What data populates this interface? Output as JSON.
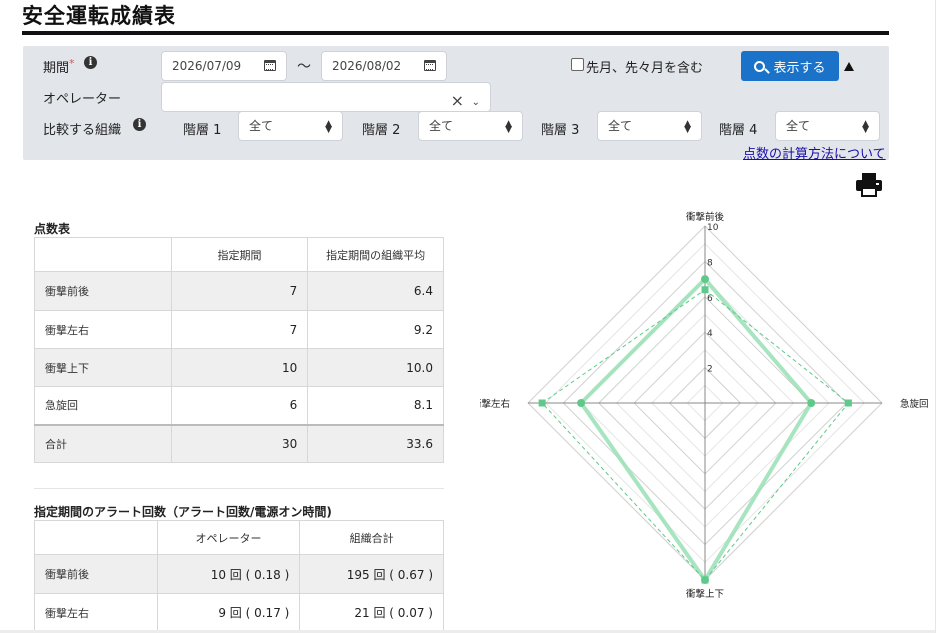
{
  "page": {
    "title": "安全運転成績表"
  },
  "filters": {
    "period_label": "期間",
    "required_mark": "*",
    "info_glyph": "i",
    "date_from": "2026/07/09",
    "date_to": "2026/08/02",
    "range_sep": "〜",
    "include_prev_label": "先月、先々月を含む",
    "include_prev_checked": false,
    "show_button_label": "表示する",
    "operator_label": "オペレーター",
    "operator_value": "",
    "clear_glyph": "×",
    "chevron_glyph": "⌄",
    "compare_label": "比較する組織",
    "levels": [
      {
        "label": "階層 1",
        "value": "全て"
      },
      {
        "label": "階層 2",
        "value": "全て"
      },
      {
        "label": "階層 3",
        "value": "全て"
      },
      {
        "label": "階層 4",
        "value": "全て"
      }
    ],
    "calc_link": "点数の計算方法について"
  },
  "score_table": {
    "title": "点数表",
    "headers": [
      "",
      "指定期間",
      "指定期間の組織平均"
    ],
    "rows": [
      {
        "name": "衝撃前後",
        "period": "7",
        "avg": "6.4"
      },
      {
        "name": "衝撃左右",
        "period": "7",
        "avg": "9.2"
      },
      {
        "name": "衝撃上下",
        "period": "10",
        "avg": "10.0"
      },
      {
        "name": "急旋回",
        "period": "6",
        "avg": "8.1"
      }
    ],
    "total": {
      "name": "合計",
      "period": "30",
      "avg": "33.6"
    }
  },
  "alert_table": {
    "title": "指定期間のアラート回数（アラート回数/電源オン時間)",
    "headers": [
      "",
      "オペレーター",
      "組織合計"
    ],
    "rows": [
      {
        "name": "衝撃前後",
        "operator": "10 回 ( 0.18 )",
        "org": "195 回 ( 0.67 )"
      },
      {
        "name": "衝撃左右",
        "operator": "9 回 ( 0.17 )",
        "org": "21 回 ( 0.07 )"
      }
    ]
  },
  "chart_data": {
    "type": "radar",
    "axes": [
      "衝撃前後",
      "急旋回",
      "衝撃上下",
      "衝撃左右"
    ],
    "scale_ticks": [
      "2",
      "4",
      "6",
      "8",
      "10"
    ],
    "rmax": 10,
    "series": [
      {
        "values": [
          7,
          6,
          10,
          7
        ],
        "color": "#96e0b4"
      },
      {
        "values": [
          6.4,
          8.1,
          10.0,
          9.2
        ],
        "color": "#5fc98a"
      }
    ]
  },
  "colors": {
    "primary": "#1a73c8",
    "panel": "#e2e5ea",
    "required": "#d9534f",
    "link": "#1a0dab"
  },
  "icons": {
    "calendar": "calendar-icon",
    "search": "search-icon",
    "printer": "printer-icon",
    "info": "info-icon"
  }
}
